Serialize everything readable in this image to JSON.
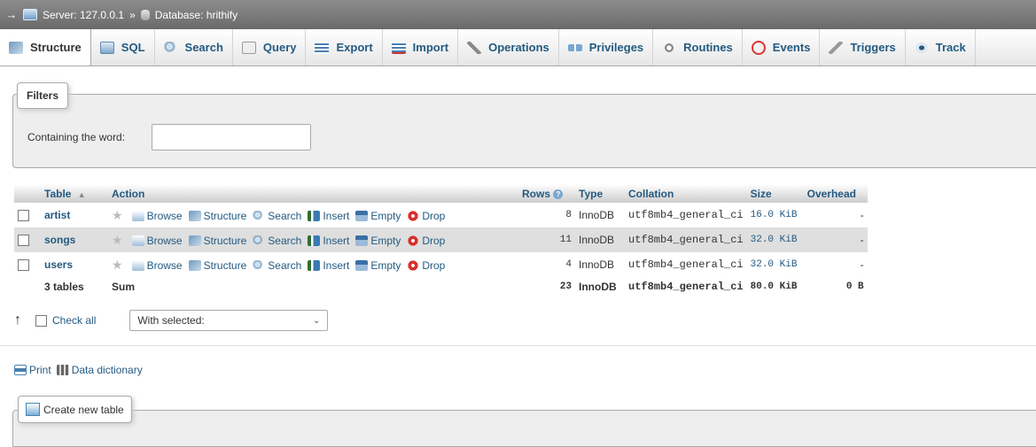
{
  "breadcrumb": {
    "arrow": "→",
    "server_label": "Server: 127.0.0.1",
    "separator": "»",
    "database_label": "Database: hrithify"
  },
  "tabs": [
    {
      "label": "Structure",
      "icon": "structure-icon",
      "active": true
    },
    {
      "label": "SQL",
      "icon": "sql-icon"
    },
    {
      "label": "Search",
      "icon": "search-icon"
    },
    {
      "label": "Query",
      "icon": "query-icon"
    },
    {
      "label": "Export",
      "icon": "export-icon"
    },
    {
      "label": "Import",
      "icon": "import-icon"
    },
    {
      "label": "Operations",
      "icon": "wrench-icon"
    },
    {
      "label": "Privileges",
      "icon": "privileges-icon"
    },
    {
      "label": "Routines",
      "icon": "routines-icon"
    },
    {
      "label": "Events",
      "icon": "clock-icon"
    },
    {
      "label": "Triggers",
      "icon": "triggers-icon"
    },
    {
      "label": "Track",
      "icon": "eye-icon"
    }
  ],
  "filters": {
    "legend": "Filters",
    "containing_label": "Containing the word:",
    "input_value": ""
  },
  "table": {
    "headers": {
      "table": "Table",
      "sort_indicator": "▲",
      "action": "Action",
      "rows": "Rows",
      "type": "Type",
      "collation": "Collation",
      "size": "Size",
      "overhead": "Overhead"
    },
    "actions": {
      "browse": "Browse",
      "structure": "Structure",
      "search": "Search",
      "insert": "Insert",
      "empty": "Empty",
      "drop": "Drop"
    },
    "rows": [
      {
        "name": "artist",
        "rows": "8",
        "type": "InnoDB",
        "collation": "utf8mb4_general_ci",
        "size": "16.0 KiB",
        "overhead": "-"
      },
      {
        "name": "songs",
        "rows": "11",
        "type": "InnoDB",
        "collation": "utf8mb4_general_ci",
        "size": "32.0 KiB",
        "overhead": "-"
      },
      {
        "name": "users",
        "rows": "4",
        "type": "InnoDB",
        "collation": "utf8mb4_general_ci",
        "size": "32.0 KiB",
        "overhead": "-"
      }
    ],
    "summary": {
      "count": "3 tables",
      "label": "Sum",
      "rows": "23",
      "type": "InnoDB",
      "collation": "utf8mb4_general_ci",
      "size": "80.0 KiB",
      "overhead": "0 B"
    }
  },
  "controls": {
    "check_all": "Check all",
    "with_selected": "With selected:"
  },
  "links": {
    "print": "Print",
    "data_dictionary": "Data dictionary"
  },
  "create": {
    "label": "Create new table"
  },
  "colors": {
    "link": "#235a81",
    "topbar": "#7a7a7a",
    "drop": "#d9302c"
  }
}
